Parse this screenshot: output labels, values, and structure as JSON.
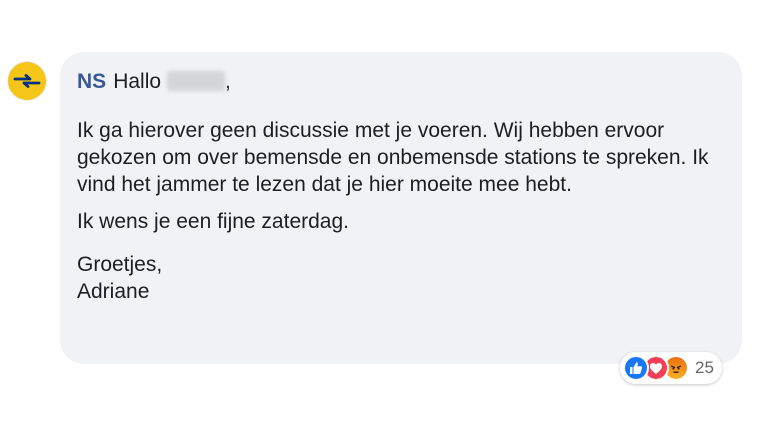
{
  "comment": {
    "author": "NS",
    "greeting": "Hallo",
    "greeting_suffix": ",",
    "paragraphs": [
      "Ik ga hierover geen discussie met je voeren. Wij hebben ervoor gekozen om over bemensde en onbemensde stations te spreken. Ik vind het jammer te lezen dat je hier moeite mee hebt.",
      "Ik wens je een fijne zaterdag.",
      "Groetjes,",
      "Adriane"
    ]
  },
  "reactions": {
    "icons": [
      "like-icon",
      "love-icon",
      "angry-icon"
    ],
    "count": "25"
  },
  "colors": {
    "bubble_bg": "#f0f2f5",
    "author": "#385898",
    "like": "#1877f2",
    "love": "#f33e58",
    "angry": "#e9710f",
    "ns_yellow": "#f5c518",
    "ns_blue": "#003082"
  }
}
